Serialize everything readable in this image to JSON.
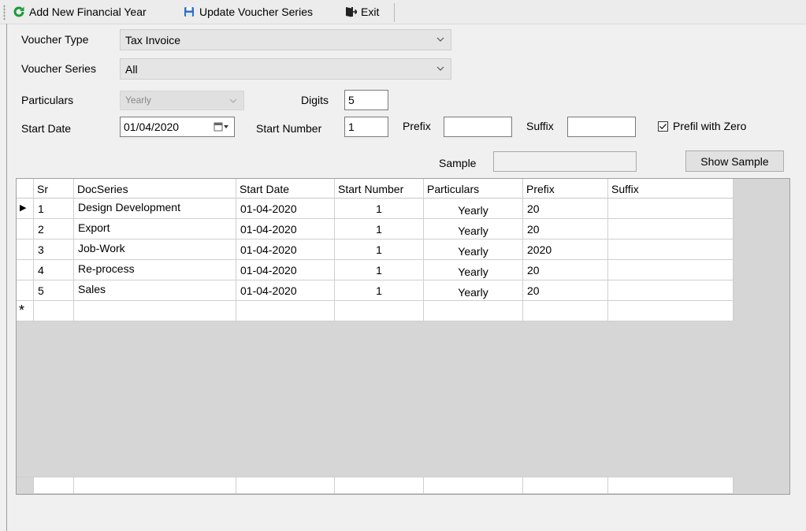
{
  "toolbar": {
    "add_label": "Add New Financial Year",
    "update_label": "Update Voucher Series",
    "exit_label": "Exit"
  },
  "form": {
    "voucher_type_label": "Voucher Type",
    "voucher_type_value": "Tax Invoice",
    "voucher_series_label": "Voucher Series",
    "voucher_series_value": "All",
    "particulars_label": "Particulars",
    "particulars_value": "Yearly",
    "digits_label": "Digits",
    "digits_value": "5",
    "start_date_label": "Start Date",
    "start_date_value": "01/04/2020",
    "start_number_label": "Start Number",
    "start_number_value": "1",
    "prefix_label": "Prefix",
    "prefix_value": "",
    "suffix_label": "Suffix",
    "suffix_value": "",
    "prefil_label": "Prefil with Zero",
    "prefil_checked": true,
    "sample_label": "Sample",
    "sample_value": "",
    "show_sample_label": "Show Sample"
  },
  "grid": {
    "columns": [
      "Sr",
      "DocSeries",
      "Start Date",
      "Start Number",
      "Particulars",
      "Prefix",
      "Suffix"
    ],
    "rows": [
      {
        "sr": "1",
        "docseries": "Design Development",
        "start_date": "01-04-2020",
        "start_number": "1",
        "particulars": "Yearly",
        "prefix": "20",
        "suffix": ""
      },
      {
        "sr": "2",
        "docseries": "Export",
        "start_date": "01-04-2020",
        "start_number": "1",
        "particulars": "Yearly",
        "prefix": "20",
        "suffix": ""
      },
      {
        "sr": "3",
        "docseries": "Job-Work",
        "start_date": "01-04-2020",
        "start_number": "1",
        "particulars": "Yearly",
        "prefix": "2020",
        "suffix": ""
      },
      {
        "sr": "4",
        "docseries": "Re-process",
        "start_date": "01-04-2020",
        "start_number": "1",
        "particulars": "Yearly",
        "prefix": "20",
        "suffix": ""
      },
      {
        "sr": "5",
        "docseries": "Sales",
        "start_date": "01-04-2020",
        "start_number": "1",
        "particulars": "Yearly",
        "prefix": "20",
        "suffix": ""
      }
    ],
    "new_row_marker": "*",
    "current_row_marker": "▶"
  },
  "colors": {
    "refresh_icon": "#1a9a3a",
    "save_icon": "#2f6fc4"
  }
}
